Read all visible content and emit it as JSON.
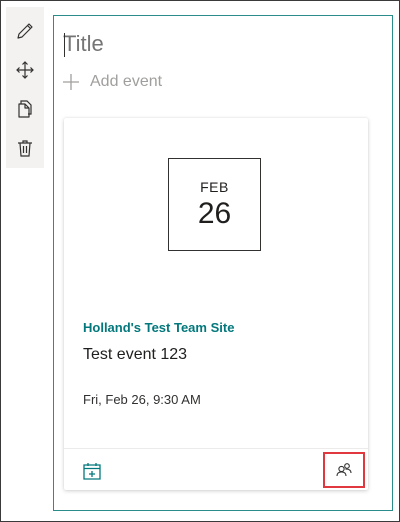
{
  "webpart": {
    "title_placeholder": "Title",
    "add_event_label": "Add event"
  },
  "toolbar": {
    "icons": [
      "pencil-icon",
      "move-icon",
      "copy-icon",
      "delete-icon"
    ]
  },
  "event": {
    "month": "FEB",
    "day": "26",
    "site_name": "Holland's Test Team Site",
    "title": "Test event 123",
    "datetime": "Fri, Feb 26, 9:30 AM"
  },
  "colors": {
    "accent": "#03787c",
    "highlight": "#e0383e",
    "webpart_border": "#2b8c8c"
  }
}
